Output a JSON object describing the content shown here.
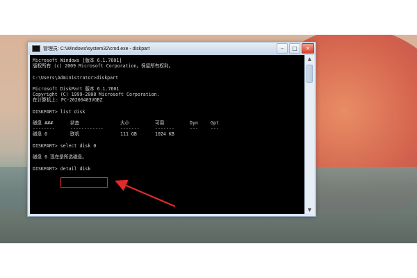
{
  "window": {
    "title": "管理员: C:\\Windows\\system32\\cmd.exe - diskpart",
    "controls": {
      "minimize": "–",
      "maximize": "□",
      "close": "×"
    }
  },
  "console": {
    "lines": [
      "Microsoft Windows [版本 6.1.7601]",
      "版权所有 (c) 2009 Microsoft Corporation。保留所有权利。",
      "",
      "C:\\Users\\Administrator>diskpart",
      "",
      "Microsoft DiskPart 版本 6.1.7601",
      "Copyright (C) 1999-2008 Microsoft Corporation.",
      "在计算机上: PC-20200403VGBZ",
      "",
      "DISKPART> list disk",
      ""
    ],
    "table": {
      "header": [
        "磁盘 ###",
        "状态",
        "大小",
        "可用",
        "Dyn",
        "Gpt"
      ],
      "divider": [
        "--------",
        "------------",
        "-------",
        "-------",
        "---",
        "---"
      ],
      "rows": [
        [
          "磁盘 0",
          "联机",
          "111 GB",
          "1024 KB",
          "",
          ""
        ]
      ]
    },
    "after_table": [
      "",
      "DISKPART> select disk 0",
      "",
      "磁盘 0 现在是所选磁盘。",
      "",
      "DISKPART> detail disk"
    ]
  },
  "scrollbar": {
    "up": "▲",
    "down": "▼"
  },
  "colors": {
    "highlight": "#e12a2a",
    "console_bg": "#000000",
    "console_text": "#d6d6d6"
  }
}
